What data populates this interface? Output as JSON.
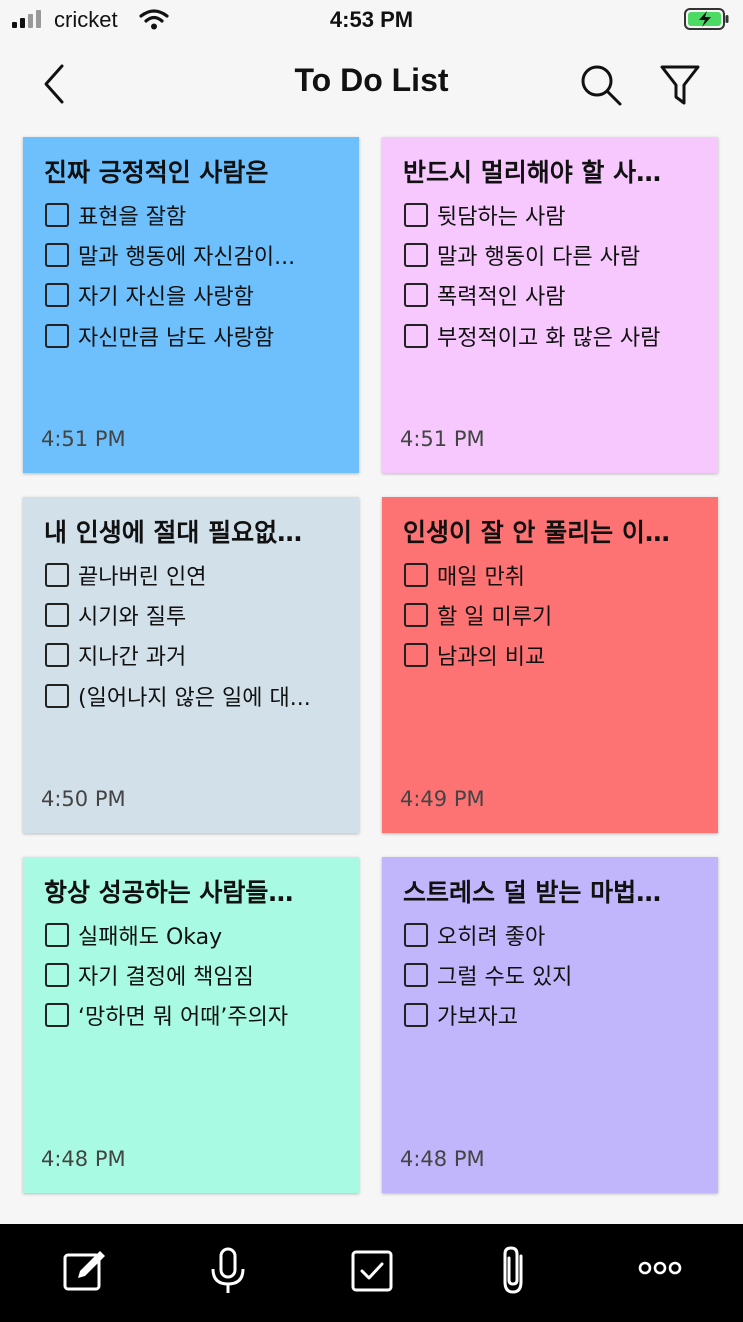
{
  "status_bar": {
    "carrier": "cricket",
    "time": "4:53 PM"
  },
  "nav": {
    "title": "To Do List",
    "back_icon": "chevron-left-icon",
    "search_icon": "search-icon",
    "filter_icon": "filter-icon"
  },
  "notes": [
    {
      "title": "진짜 긍정적인 사람은",
      "color": "#6dc0fb",
      "items": [
        "표현을 잘함",
        "말과 행동에 자신감이...",
        "자기 자신을 사랑함",
        "자신만큼 남도 사랑함"
      ],
      "time": "4:51 PM"
    },
    {
      "title": "반드시 멀리해야 할 사…",
      "color": "#f6c8fd",
      "items": [
        "뒷담하는 사람",
        "말과 행동이 다른 사람",
        "폭력적인 사람",
        "부정적이고 화 많은 사람"
      ],
      "time": "4:51 PM"
    },
    {
      "title": "내 인생에 절대 필요없…",
      "color": "#d2e0ea",
      "items": [
        "끝나버린 인연",
        "시기와 질투",
        "지나간 과거",
        "(일어나지 않은 일에 대..."
      ],
      "time": "4:50 PM"
    },
    {
      "title": "인생이 잘 안 풀리는 이…",
      "color": "#fd7272",
      "items": [
        "매일 만취",
        "할 일 미루기",
        "남과의 비교"
      ],
      "time": "4:49 PM"
    },
    {
      "title": "항상 성공하는 사람들…",
      "color": "#a8fbe2",
      "items": [
        "실패해도 Okay",
        "자기 결정에 책임짐",
        "‘망하면 뭐 어때’주의자"
      ],
      "time": "4:48 PM"
    },
    {
      "title": "스트레스 덜 받는 마법…",
      "color": "#c1b5fc",
      "items": [
        "오히려 좋아",
        "그럴 수도 있지",
        "가보자고"
      ],
      "time": "4:48 PM"
    }
  ],
  "toolbar": {
    "icons": [
      "compose-icon",
      "microphone-icon",
      "checkbox-icon",
      "paperclip-icon",
      "more-icon"
    ]
  }
}
